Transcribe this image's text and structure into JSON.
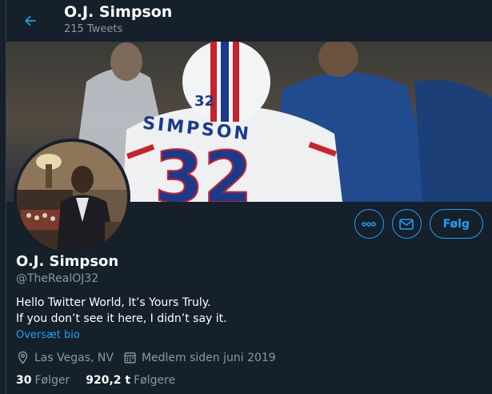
{
  "header": {
    "name": "O.J. Simpson",
    "tweet_count": "215 Tweets"
  },
  "banner": {
    "jersey_name": "SIMPSON",
    "jersey_number": "32",
    "helmet_number": "32"
  },
  "profile": {
    "name": "O.J. Simpson",
    "handle": "@TheRealOJ32",
    "bio_line1": "Hello Twitter World, It’s Yours Truly.",
    "bio_line2": "If you don’t see it here, I didn’t say it.",
    "translate_label": "Oversæt bio",
    "location": "Las Vegas, NV",
    "joined": "Medlem siden juni 2019",
    "following_count": "30",
    "following_label": "Følger",
    "followers_count": "920,2 t",
    "followers_label": "Følgere"
  },
  "actions": {
    "follow_label": "Følg",
    "more_icon": "more-icon",
    "message_icon": "message-icon"
  },
  "colors": {
    "background": "#15202b",
    "accent": "#1da1f2",
    "muted": "#8899a6"
  }
}
